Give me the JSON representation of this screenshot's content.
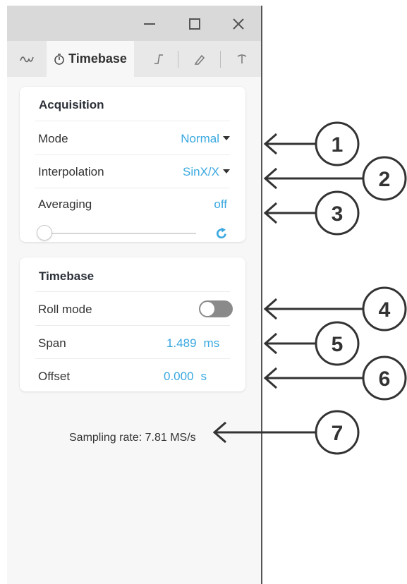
{
  "window_controls": {
    "minimize_icon": "minimize-icon",
    "maximize_icon": "maximize-icon",
    "close_icon": "close-icon"
  },
  "tabs": [
    {
      "icon": "waveform-icon",
      "label": ""
    },
    {
      "icon": "stopwatch-icon",
      "label": "Timebase",
      "active": true
    },
    {
      "icon": "trigger-edge-icon",
      "label": ""
    },
    {
      "icon": "pencil-icon",
      "label": ""
    },
    {
      "icon": "probe-icon",
      "label": ""
    }
  ],
  "acquisition": {
    "title": "Acquisition",
    "mode_label": "Mode",
    "mode_value": "Normal",
    "interpolation_label": "Interpolation",
    "interpolation_value": "SinX/X",
    "averaging_label": "Averaging",
    "averaging_value": "off",
    "averaging_slider_level": 0,
    "reset_icon": "reset-icon"
  },
  "timebase": {
    "title": "Timebase",
    "roll_mode_label": "Roll mode",
    "roll_mode_on": false,
    "span_label": "Span",
    "span_value": "1.489",
    "span_unit": "ms",
    "offset_label": "Offset",
    "offset_value": "0.000",
    "offset_unit": "s"
  },
  "sampling_rate": "Sampling rate: 7.81 MS/s",
  "callouts": [
    "1",
    "2",
    "3",
    "4",
    "5",
    "6",
    "7"
  ],
  "colors": {
    "accent": "#3aa8e0",
    "annotation": "#333333",
    "toggle_off": "#8a8a8a"
  }
}
